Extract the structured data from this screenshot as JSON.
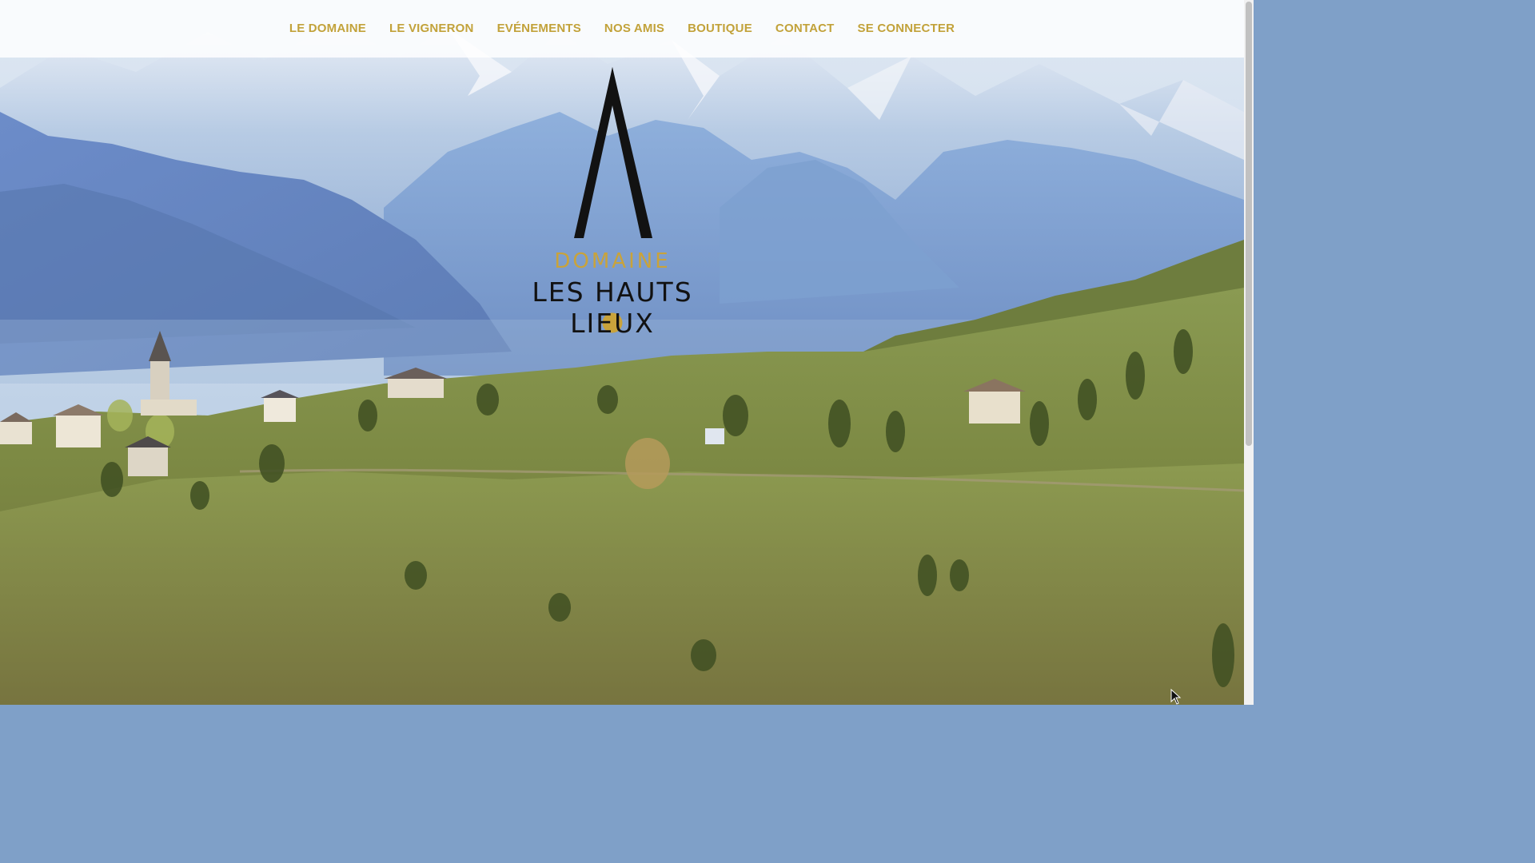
{
  "nav": {
    "items": [
      {
        "label": "LE DOMAINE"
      },
      {
        "label": "LE VIGNERON"
      },
      {
        "label": "EVÉNEMENTS"
      },
      {
        "label": "NOS AMIS"
      },
      {
        "label": "BOUTIQUE"
      },
      {
        "label": "CONTACT"
      },
      {
        "label": "SE CONNECTER"
      }
    ],
    "color": "#c2a23a"
  },
  "logo": {
    "line1": "DOMAINE",
    "line2": "LES HAUTS LIEUX",
    "gold": "#c9a33b",
    "red": "#c0202a",
    "dark": "#121212"
  },
  "icons": {
    "mark": "mountain-peak-icon",
    "dot": "gold-dot-icon",
    "cursor": "mouse-pointer-icon"
  }
}
